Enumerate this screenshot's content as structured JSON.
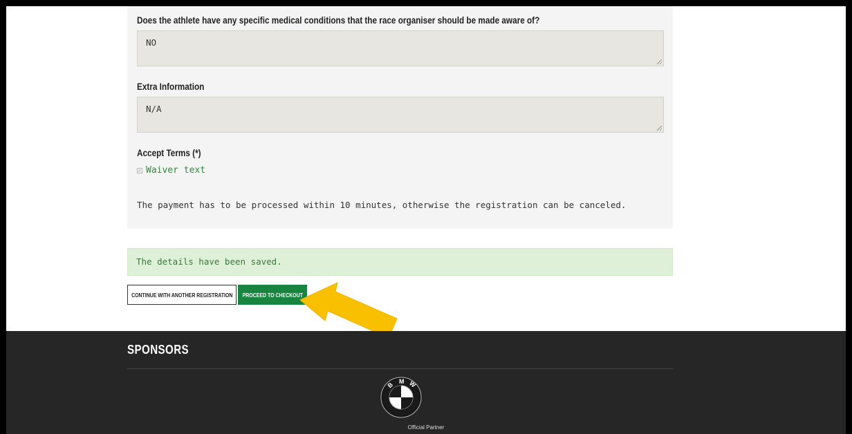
{
  "form": {
    "medical_question": "Does the athlete have any specific medical conditions that the race organiser should be made aware of?",
    "medical_value": "NO",
    "extra_label": "Extra Information",
    "extra_value": "N/A",
    "terms_label": "Accept Terms (*)",
    "waiver_link": "Waiver text",
    "waiver_checked": true,
    "payment_note": "The payment has to be processed within 10 minutes, otherwise the registration can be canceled."
  },
  "alert": {
    "message": "The details have been saved."
  },
  "actions": {
    "continue_label": "CONTINUE WITH ANOTHER REGISTRATION",
    "checkout_label": "PROCEED TO CHECKOUT"
  },
  "footer": {
    "title": "SPONSORS",
    "sponsor_logo_text": "BMW",
    "sponsor_caption": "Official Partner"
  },
  "colors": {
    "accent_green": "#17843f",
    "success_bg": "#dff0d8",
    "footer_bg": "#262626",
    "annotation_arrow": "#f9c000"
  },
  "icons": {
    "resize_grip": "resize-grip-icon",
    "annotation": "arrow-annotation-icon",
    "sponsor": "bmw-logo-icon"
  }
}
